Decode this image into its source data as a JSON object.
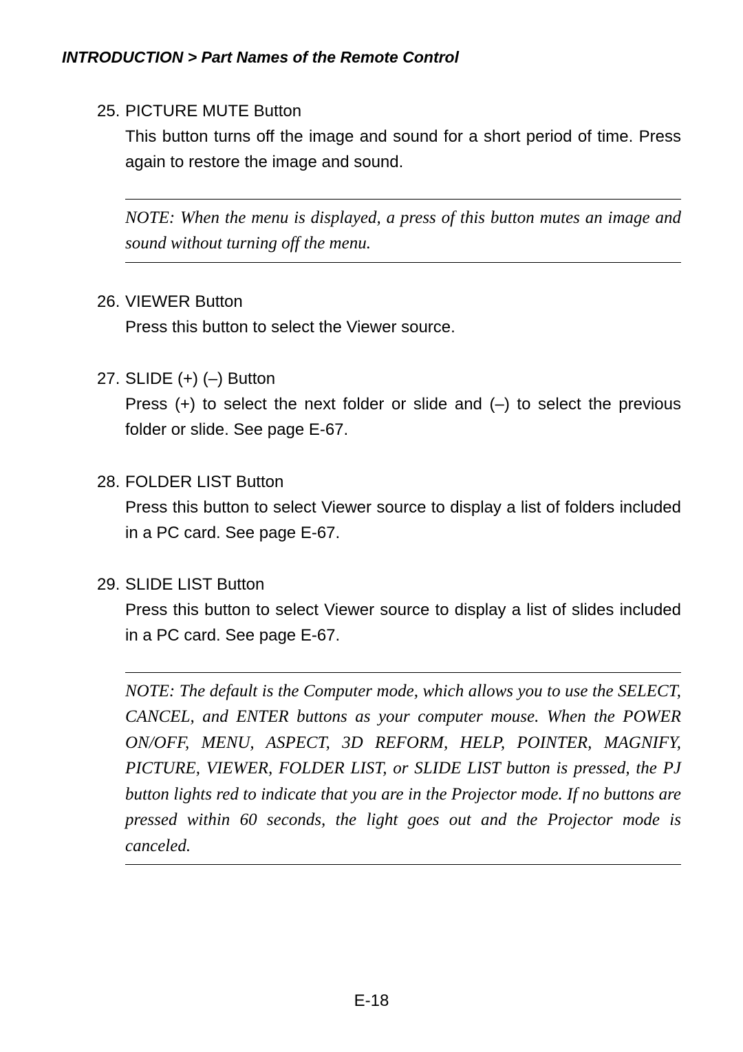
{
  "breadcrumb": {
    "section": "INTRODUCTION",
    "separator": ">",
    "subsection": "Part Names of the Remote Control"
  },
  "items": [
    {
      "number": "25.",
      "title": "PICTURE MUTE Button",
      "description": "This button turns off the image and sound for a short period of time. Press again to restore the image and sound."
    },
    {
      "number": "26.",
      "title": "VIEWER Button",
      "description": "Press this button to select the Viewer source."
    },
    {
      "number": "27.",
      "title": "SLIDE (+) (–) Button",
      "description": "Press (+) to select the next folder or slide and (–) to select the previous folder or slide. See page E-67."
    },
    {
      "number": "28.",
      "title": "FOLDER LIST Button",
      "description": "Press this button to select Viewer source to display a list of folders included in a PC card. See page E-67."
    },
    {
      "number": "29.",
      "title": "SLIDE LIST Button",
      "description": "Press this button to select Viewer source to display a list of slides included in a PC card. See page E-67."
    }
  ],
  "notes": [
    "NOTE: When the menu is displayed, a press of this button mutes an image and sound without turning off the menu.",
    "NOTE: The default is the Computer mode, which allows you to use the SELECT, CANCEL, and ENTER buttons as your computer mouse. When the POWER ON/OFF, MENU, ASPECT, 3D REFORM, HELP, POINTER, MAGNIFY, PICTURE, VIEWER, FOLDER LIST, or SLIDE LIST button is pressed, the PJ button lights red to indicate that you are in the Projector mode. If no buttons are pressed within 60 seconds, the light goes out and the Projector mode is canceled."
  ],
  "pageNumber": "E-18"
}
